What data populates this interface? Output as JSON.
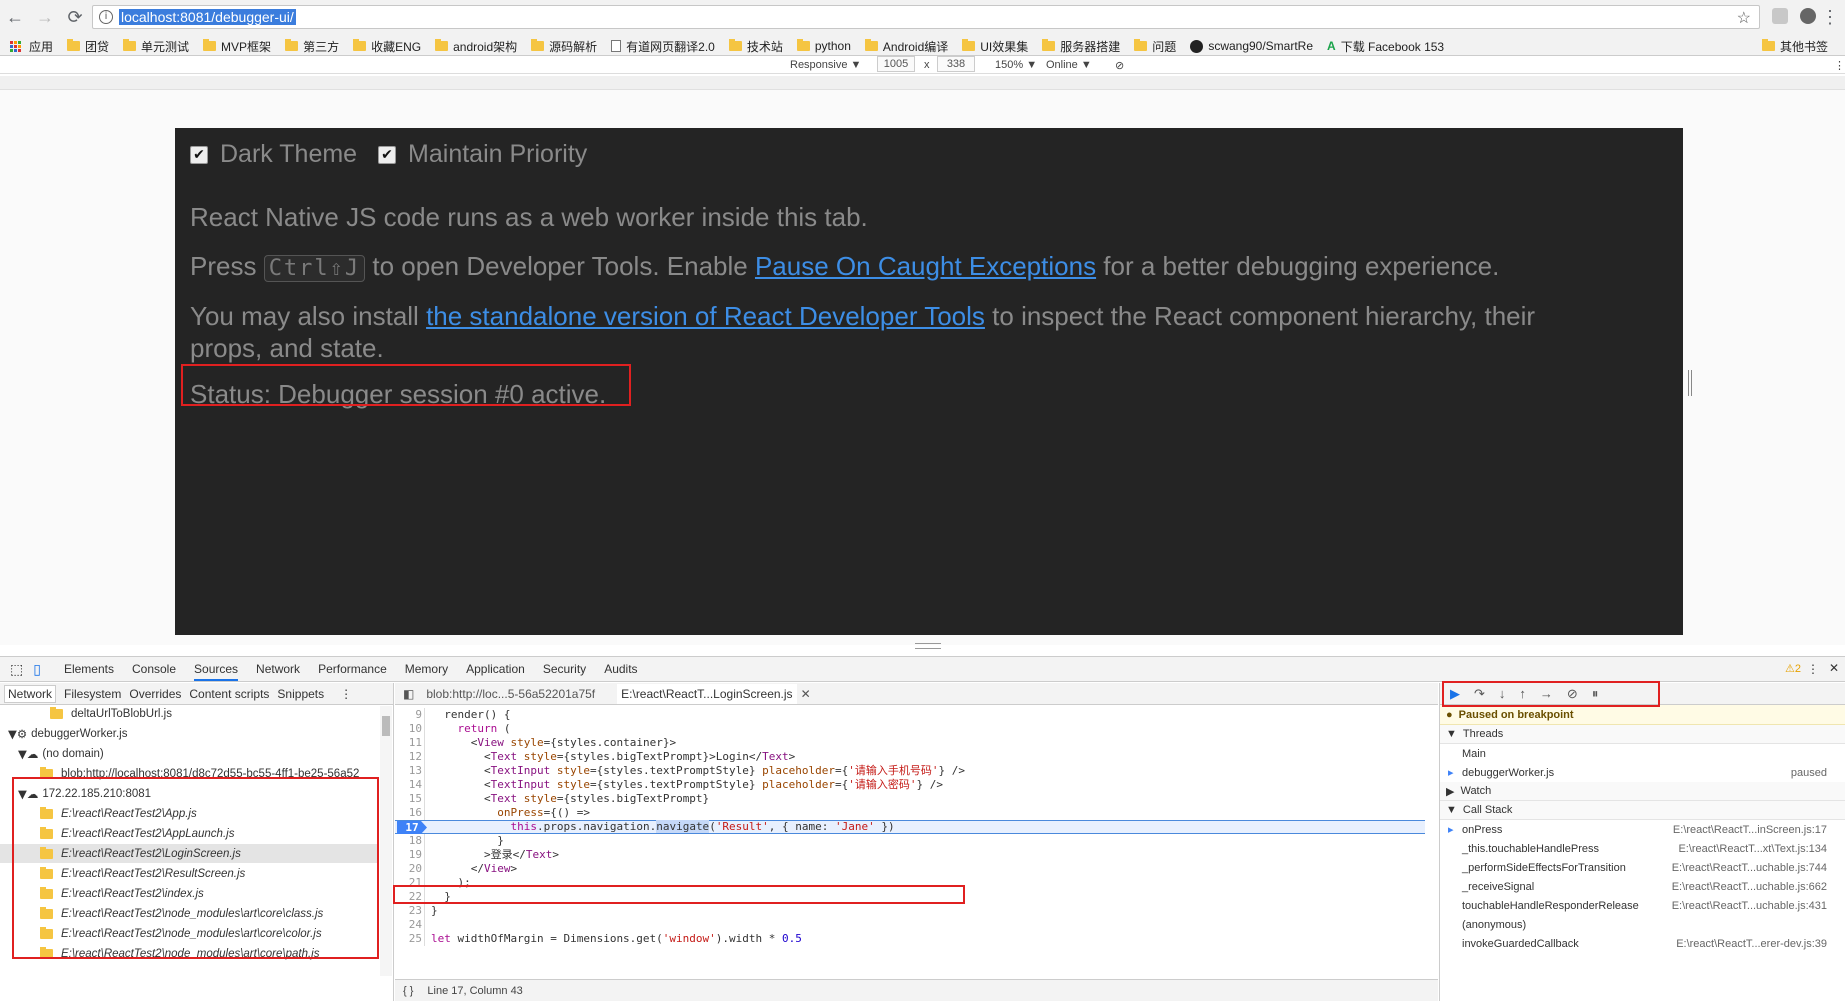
{
  "browser": {
    "url": "localhost:8081/debugger-ui/",
    "bookmarks": [
      "应用",
      "团贷",
      "单元测试",
      "MVP框架",
      "第三方",
      "收藏ENG",
      "android架构",
      "源码解析",
      "有道网页翻译2.0",
      "技术站",
      "python",
      "Android编译",
      "UI效果集",
      "服务器搭建",
      "问题",
      "scwang90/SmartRe",
      "下载 Facebook 153",
      "其他书签"
    ]
  },
  "device_toolbar": {
    "mode": "Responsive ▼",
    "width": "1005",
    "x": "x",
    "height": "338",
    "zoom": "150% ▼",
    "network": "Online ▼"
  },
  "debugger_page": {
    "dark_theme": "Dark Theme",
    "maintain_priority": "Maintain Priority",
    "line1": "React Native JS code runs as a web worker inside this tab.",
    "line2_pre": "Press ",
    "line2_kbd": "Ctrl⇧J",
    "line2_mid": " to open Developer Tools. Enable ",
    "line2_link": "Pause On Caught Exceptions",
    "line2_post": " for a better debugging experience.",
    "line3_pre": "You may also install ",
    "line3_link": "the standalone version of React Developer Tools",
    "line3_post": " to inspect the React component hierarchy, their",
    "line3b": "props, and state.",
    "status": "Status: Debugger session #0 active."
  },
  "devtools": {
    "tabs": [
      "Elements",
      "Console",
      "Sources",
      "Network",
      "Performance",
      "Memory",
      "Application",
      "Security",
      "Audits"
    ],
    "warning_count": "⚠2",
    "left_tabs": [
      "Network",
      "Filesystem",
      "Overrides",
      "Content scripts",
      "Snippets"
    ],
    "tree": [
      {
        "label": "deltaUrlToBlobUrl.js",
        "type": "file"
      },
      {
        "label": "debuggerWorker.js",
        "type": "gear"
      },
      {
        "label": "(no domain)",
        "type": "cloud"
      },
      {
        "label": "blob:http://localhost:8081/d8c72d55-bc55-4ff1-be25-56a52",
        "type": "file"
      },
      {
        "label": "172.22.185.210:8081",
        "type": "cloud"
      },
      {
        "label": "E:\\react\\ReactTest2\\App.js",
        "type": "file"
      },
      {
        "label": "E:\\react\\ReactTest2\\AppLaunch.js",
        "type": "file"
      },
      {
        "label": "E:\\react\\ReactTest2\\LoginScreen.js",
        "type": "file",
        "selected": true
      },
      {
        "label": "E:\\react\\ReactTest2\\ResultScreen.js",
        "type": "file"
      },
      {
        "label": "E:\\react\\ReactTest2\\index.js",
        "type": "file"
      },
      {
        "label": "E:\\react\\ReactTest2\\node_modules\\art\\core\\class.js",
        "type": "file"
      },
      {
        "label": "E:\\react\\ReactTest2\\node_modules\\art\\core\\color.js",
        "type": "file"
      },
      {
        "label": "E:\\react\\ReactTest2\\node_modules\\art\\core\\path.js",
        "type": "file"
      }
    ],
    "file_tabs": [
      "blob:http://loc...5-56a52201a75f",
      "E:\\react\\ReactT...LoginScreen.js"
    ],
    "status_bar": "Line 17, Column 43",
    "call_stack_title": "Call Stack",
    "paused": "Paused on breakpoint",
    "threads_title": "Threads",
    "threads": [
      {
        "name": "Main",
        "state": ""
      },
      {
        "name": "debuggerWorker.js",
        "state": "paused"
      }
    ],
    "watch_title": "Watch",
    "call_stack": [
      {
        "fn": "onPress",
        "loc": "E:\\react\\ReactT...inScreen.js:17"
      },
      {
        "fn": "_this.touchableHandlePress",
        "loc": "E:\\react\\ReactT...xt\\Text.js:134"
      },
      {
        "fn": "_performSideEffectsForTransition",
        "loc": "E:\\react\\ReactT...uchable.js:744"
      },
      {
        "fn": "_receiveSignal",
        "loc": "E:\\react\\ReactT...uchable.js:662"
      },
      {
        "fn": "touchableHandleResponderRelease",
        "loc": "E:\\react\\ReactT...uchable.js:431"
      },
      {
        "fn": "(anonymous)",
        "loc": ""
      },
      {
        "fn": "invokeGuardedCallback",
        "loc": "E:\\react\\ReactT...erer-dev.js:39"
      }
    ]
  }
}
